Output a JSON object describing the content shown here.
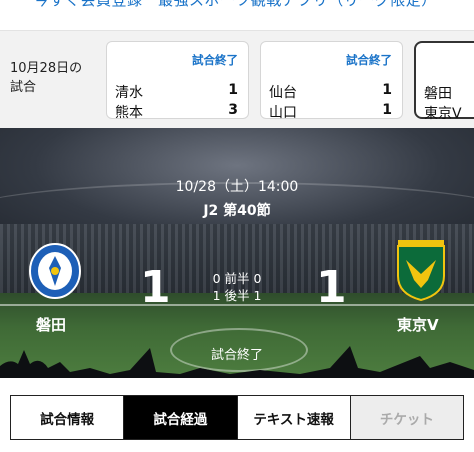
{
  "banner": {
    "text": "今すぐ会員登録　最強スポーツ観戦アプリ（リーグ限定）"
  },
  "schedule": {
    "date_label_line1": "10月28日の",
    "date_label_line2": "試合",
    "games": [
      {
        "status": "試合終了",
        "home": "清水",
        "home_score": "1",
        "away": "熊本",
        "away_score": "3"
      },
      {
        "status": "試合終了",
        "home": "仙台",
        "home_score": "1",
        "away": "山口",
        "away_score": "1"
      },
      {
        "status": "",
        "home": "磐田",
        "home_score": "",
        "away": "東京V",
        "away_score": ""
      }
    ]
  },
  "match": {
    "datetime": "10/28（土）14:00",
    "round": "J2 第40節",
    "home_team": "磐田",
    "away_team": "東京V",
    "home_score": "1",
    "away_score": "1",
    "first_half": "0 前半 0",
    "second_half": "1 後半 1",
    "status": "試合終了",
    "home_crest_icon": "jubilo-crest-icon",
    "away_crest_icon": "verdy-crest-icon"
  },
  "tabs": [
    {
      "label": "試合情報",
      "state": "normal"
    },
    {
      "label": "試合経過",
      "state": "active"
    },
    {
      "label": "テキスト速報",
      "state": "normal"
    },
    {
      "label": "チケット",
      "state": "disabled"
    }
  ],
  "colors": {
    "link_blue": "#1a73c8",
    "verdy_green": "#0c6b3a",
    "jubilo_blue": "#1d5fb7",
    "active_tab": "#000000"
  }
}
